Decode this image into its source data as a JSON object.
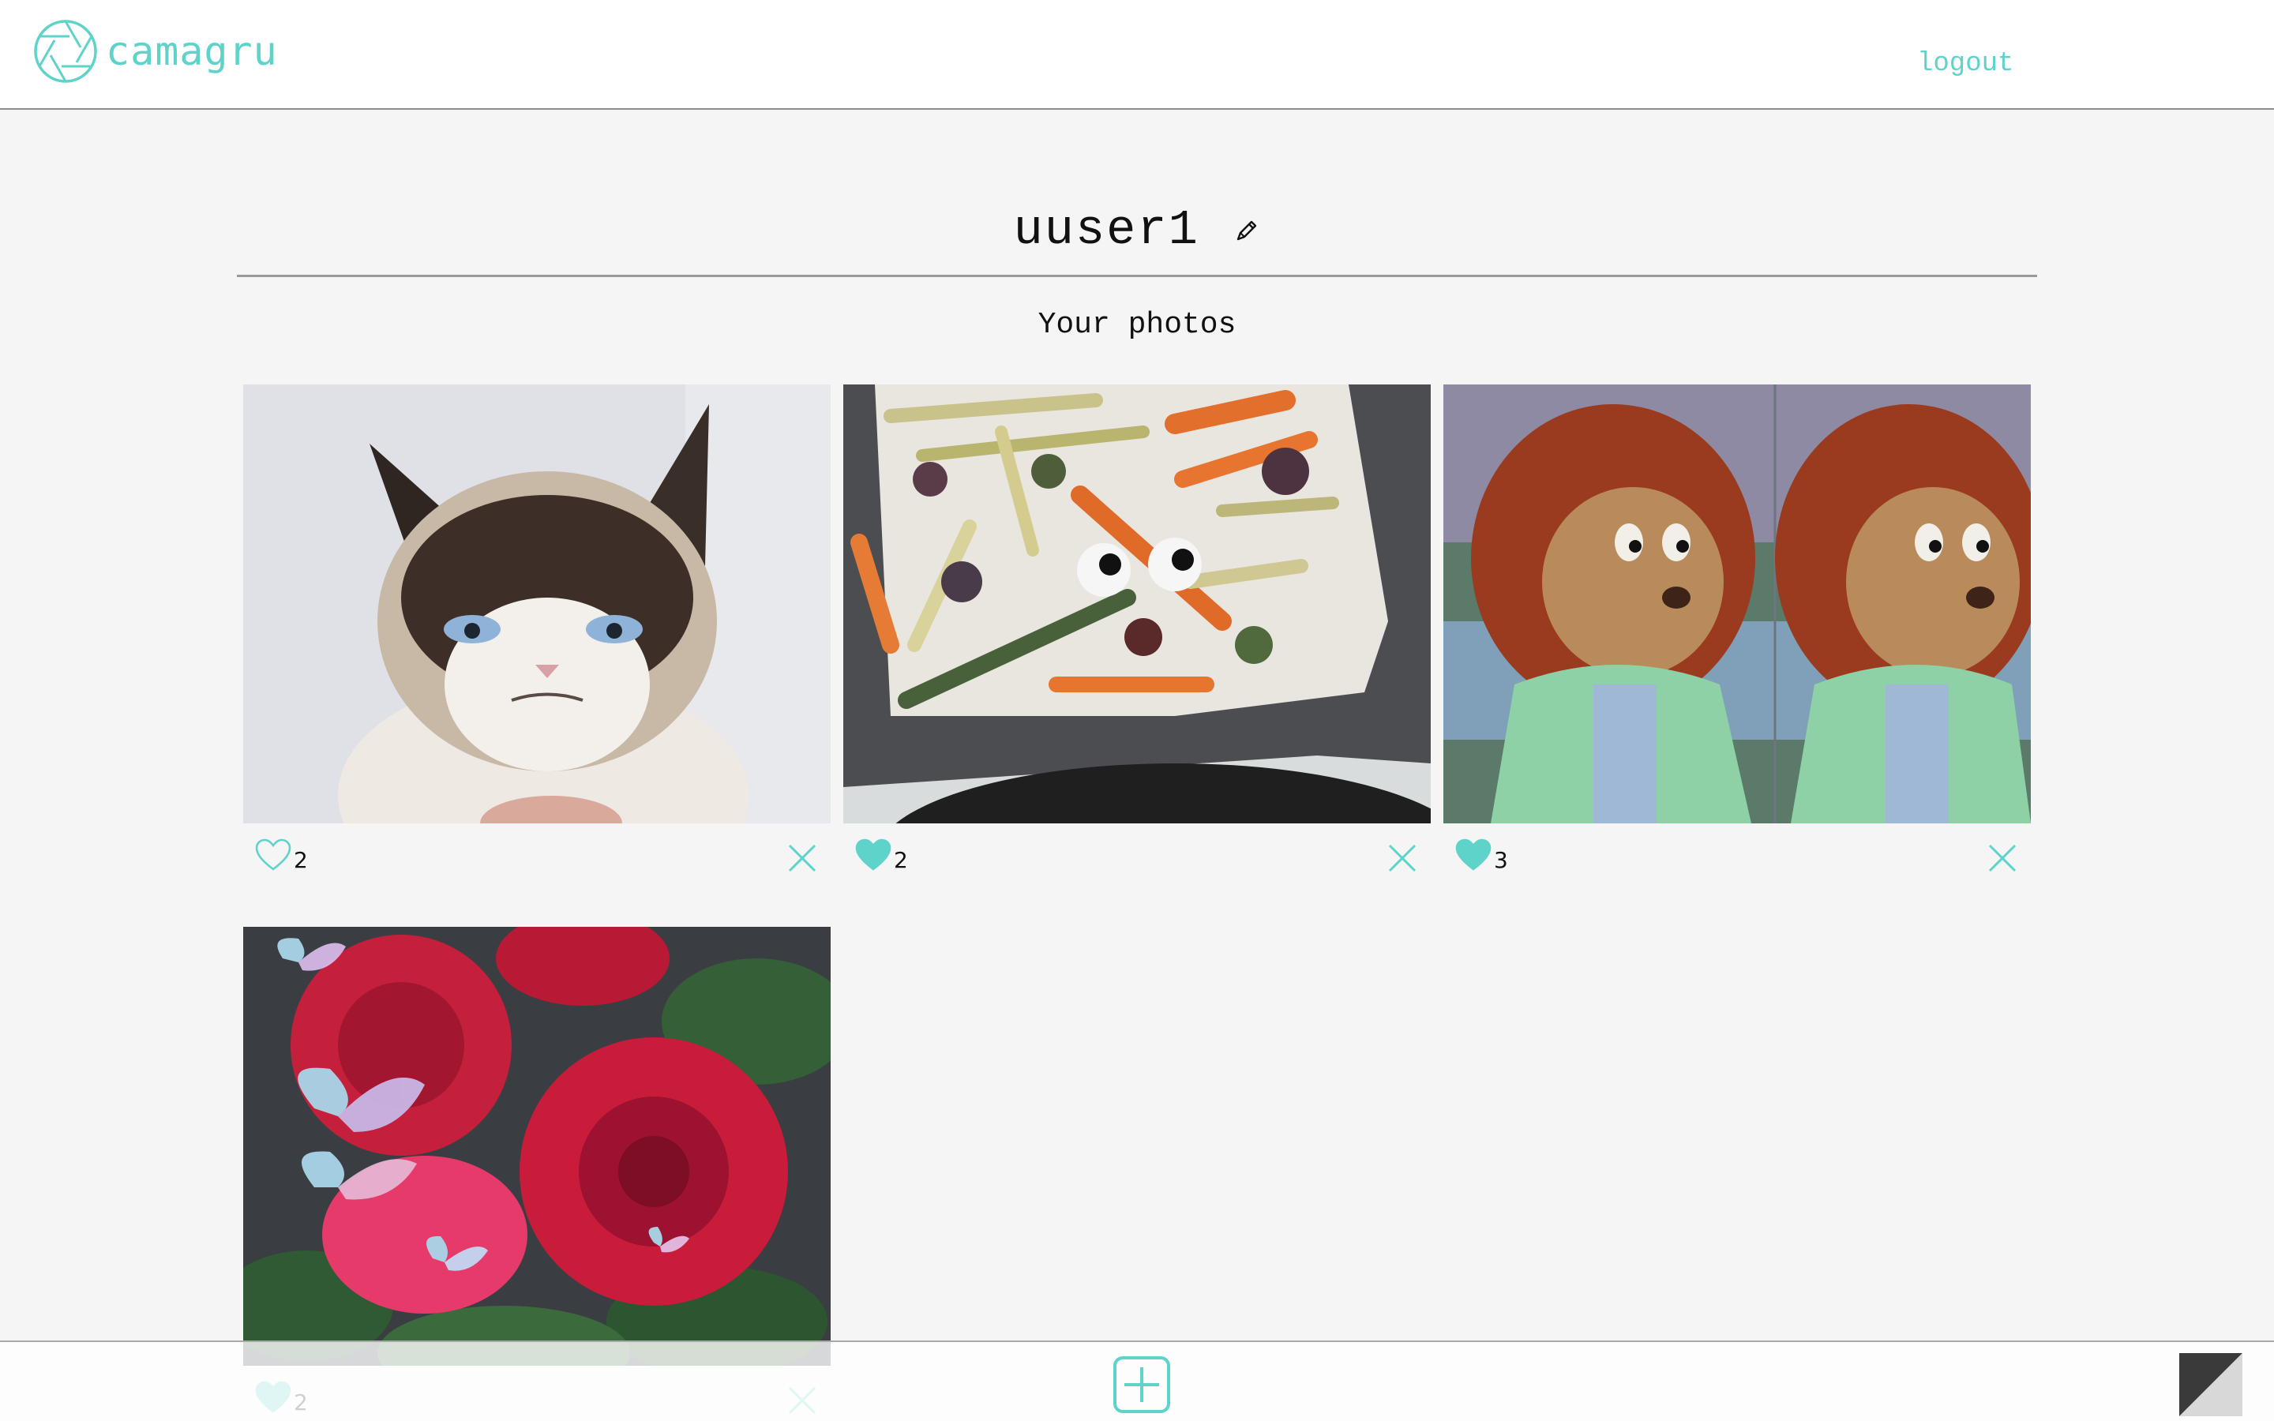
{
  "app": {
    "name": "camagru"
  },
  "header": {
    "logout_label": "logout"
  },
  "profile": {
    "username": "uuser1"
  },
  "gallery": {
    "heading": "Your photos",
    "photos": [
      {
        "subject": "grumpy cat",
        "likes": "2",
        "liked": false
      },
      {
        "subject": "roasted vegetables with googly eyes",
        "likes": "2",
        "liked": true
      },
      {
        "subject": "puppet monkey side-eye",
        "likes": "3",
        "liked": true
      },
      {
        "subject": "red roses with butterflies",
        "likes": "2",
        "liked": true
      }
    ]
  },
  "icons": {
    "logo": "camera-aperture-icon",
    "edit": "pencil-icon",
    "like": "heart-icon",
    "delete": "close-icon",
    "add": "plus-square-icon",
    "theme": "theme-toggle-icon"
  },
  "colors": {
    "accent": "#5ed3c9",
    "background": "#f5f5f5"
  }
}
